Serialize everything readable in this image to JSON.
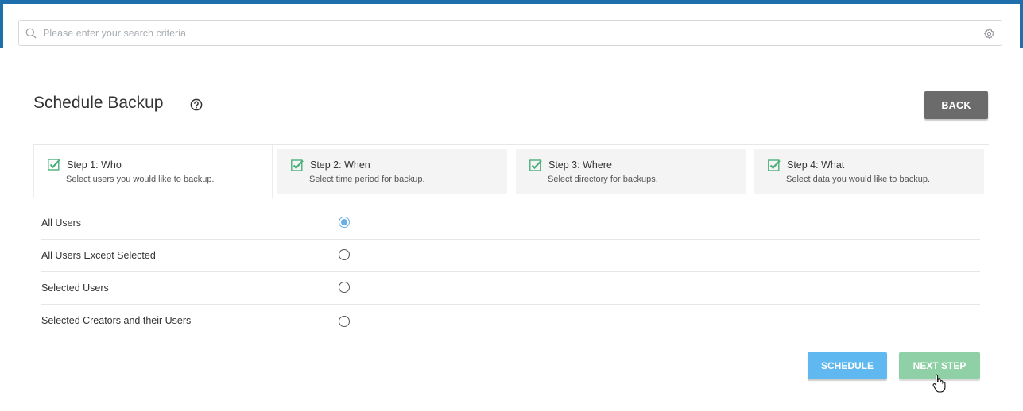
{
  "search": {
    "placeholder": "Please enter your search criteria"
  },
  "header": {
    "title": "Schedule Backup",
    "back_label": "BACK"
  },
  "steps": [
    {
      "title": "Step 1: Who",
      "description": "Select users you would like to backup.",
      "active": true,
      "checked": true
    },
    {
      "title": "Step 2: When",
      "description": "Select time period for backup.",
      "active": false,
      "checked": true
    },
    {
      "title": "Step 3: Where",
      "description": "Select directory for backups.",
      "active": false,
      "checked": true
    },
    {
      "title": "Step 4: What",
      "description": "Select data you would like to backup.",
      "active": false,
      "checked": true
    }
  ],
  "options": [
    {
      "label": "All Users",
      "selected": true
    },
    {
      "label": "All Users Except Selected",
      "selected": false
    },
    {
      "label": "Selected Users",
      "selected": false
    },
    {
      "label": "Selected Creators and their Users",
      "selected": false
    }
  ],
  "actions": {
    "schedule_label": "SCHEDULE",
    "next_label": "NEXT STEP"
  },
  "icons": {
    "search": "search-icon",
    "settings": "gear-icon",
    "help": "question-circle-icon",
    "check": "check-square-icon",
    "cursor": "hand-pointer-icon"
  },
  "colors": {
    "topbar": "#1f6fad",
    "back_button": "#6b6b6b",
    "schedule_button": "#5fb8ef",
    "next_button": "#8fd0a6",
    "check": "#4caf7a",
    "radio_selected": "#6aaee3"
  }
}
